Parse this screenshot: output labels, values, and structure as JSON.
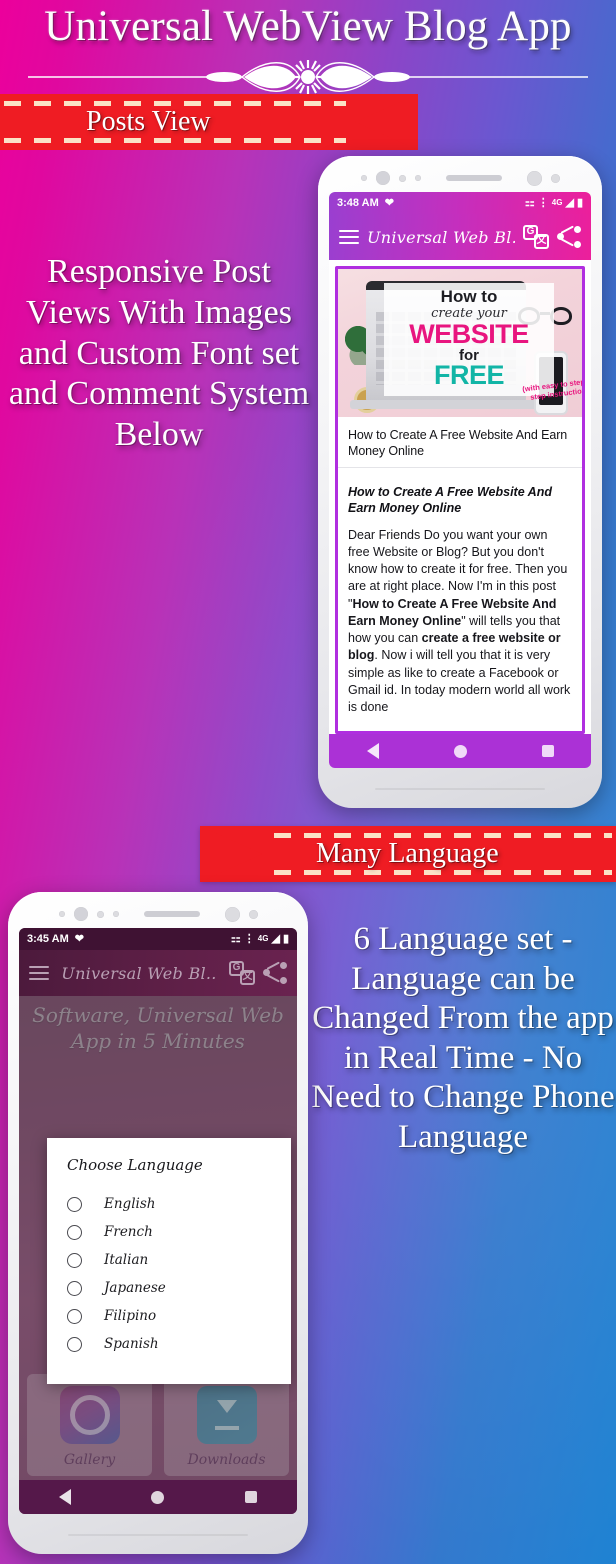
{
  "hero": {
    "title": "Universal WebView Blog App",
    "ornament": "ornamental-divider"
  },
  "banners": {
    "posts_view": "Posts View",
    "many_language": "Many Language"
  },
  "pitch": {
    "left": "Responsive Post Views With Images and Custom Font set and Comment System Below",
    "right": "6 Language set - Language can be Changed From the app in Real Time - No Need to Change Phone Language"
  },
  "colors": {
    "bg_left": "#ec009c",
    "bg_right": "#1b81d2",
    "ribbon_red": "#ef1c23",
    "ribbon_dash": "#fbe3c6",
    "appbar_pink": "#ec1f9b",
    "appbar_purple": "#9a3fd0",
    "navbar_purple": "#ab31d6",
    "post_border": "#b02ee0",
    "dialog_bg": "#ffffff"
  },
  "phone_posts": {
    "status": {
      "time": "3:48 AM",
      "heart_icon": "heart-icon",
      "cast_icon": "cast-icon",
      "vibrate_icon": "vibrate-icon",
      "network": "4G",
      "signal_icon": "signal-icon",
      "battery_icon": "battery-icon"
    },
    "appbar": {
      "menu_icon": "hamburger-menu-icon",
      "title": "Universal Web Bl..",
      "translate_icon": "translate-icon",
      "share_icon": "share-icon"
    },
    "post": {
      "image": {
        "line1": "How to",
        "line2": "create your",
        "line3": "WEBSITE",
        "line4": "for",
        "line5": "FREE",
        "note": "(with easy to step-by-step instructions)"
      },
      "title": "How to Create A Free Website And Earn Money Online",
      "heading": "How to Create A Free Website And Earn Money Online",
      "body_parts": [
        {
          "text": "Dear Friends Do you want your own free Website or Blog? But you don't know how to create it for free. Then you are at right place. Now I'm in this post \"",
          "bold": false
        },
        {
          "text": "How to Create A Free Website And Earn Money Online",
          "bold": true
        },
        {
          "text": "\" will tells you that how you can ",
          "bold": false
        },
        {
          "text": "create a free website or blog",
          "bold": true
        },
        {
          "text": ". Now i will tell you that it is very simple as like to create a Facebook or Gmail id. In today modern world all work is done",
          "bold": false
        }
      ]
    },
    "nav": {
      "back_icon": "back-triangle-icon",
      "home_icon": "home-circle-icon",
      "recents_icon": "recents-square-icon"
    }
  },
  "phone_language": {
    "status": {
      "time": "3:45 AM",
      "heart_icon": "heart-icon",
      "cast_icon": "cast-icon",
      "vibrate_icon": "vibrate-icon",
      "network": "4G",
      "signal_icon": "signal-icon",
      "battery_icon": "battery-icon"
    },
    "appbar": {
      "menu_icon": "hamburger-menu-icon",
      "title": "Universal Web Bl..",
      "translate_icon": "translate-icon",
      "share_icon": "share-icon"
    },
    "background": {
      "hero_text": "Software, Universal Web App in 5 Minutes",
      "tiles": [
        {
          "label": "Gallery",
          "icon": "gallery-icon"
        },
        {
          "label": "Downloads",
          "icon": "download-icon"
        }
      ]
    },
    "dialog": {
      "title": "Choose Language",
      "options": [
        {
          "label": "English",
          "selected": false
        },
        {
          "label": "French",
          "selected": false
        },
        {
          "label": "Italian",
          "selected": false
        },
        {
          "label": "Japanese",
          "selected": false
        },
        {
          "label": "Filipino",
          "selected": false
        },
        {
          "label": "Spanish",
          "selected": false
        }
      ]
    },
    "nav": {
      "back_icon": "back-triangle-icon",
      "home_icon": "home-circle-icon",
      "recents_icon": "recents-square-icon"
    }
  }
}
